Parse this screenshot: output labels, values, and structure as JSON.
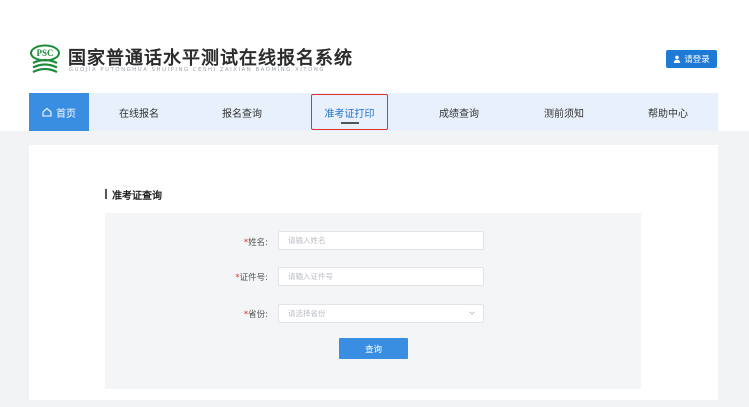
{
  "header": {
    "logo_text": "PSC",
    "title": "国家普通话水平测试在线报名系统",
    "subtitle": "GUOJIA PUTONGHUA SHUIPING CESHI ZAIXIAN BAOMING XITONG",
    "login_label": "请登录"
  },
  "nav": {
    "items": [
      {
        "label": "首页"
      },
      {
        "label": "在线报名"
      },
      {
        "label": "报名查询"
      },
      {
        "label": "准考证打印"
      },
      {
        "label": "成绩查询"
      },
      {
        "label": "测前须知"
      },
      {
        "label": "帮助中心"
      }
    ]
  },
  "main": {
    "section_title": "准考证查询",
    "form": {
      "required_mark": "*",
      "name_label": "姓名:",
      "name_placeholder": "请输入姓名",
      "id_label": "证件号:",
      "id_placeholder": "请输入证件号",
      "province_label": "省份:",
      "province_placeholder": "请选择省份",
      "query_button": "查询"
    }
  },
  "colors": {
    "accent": "#3a8ee2",
    "login_button": "#1f7ad6",
    "nav_background": "#e8f1fb",
    "highlight_box": "#e03030",
    "required": "#e03030"
  },
  "icons": {
    "logo": "psc-logo-icon",
    "login": "user-icon",
    "home": "home-icon",
    "select": "chevron-down-icon"
  }
}
